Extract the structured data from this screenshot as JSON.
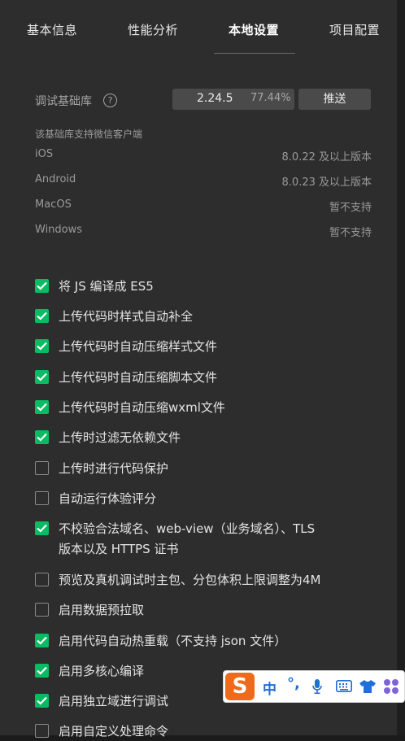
{
  "tabs": [
    {
      "label": "基本信息",
      "active": false
    },
    {
      "label": "性能分析",
      "active": false
    },
    {
      "label": "本地设置",
      "active": true
    },
    {
      "label": "项目配置",
      "active": false
    }
  ],
  "debug_lib": {
    "label": "调试基础库",
    "help_icon": "?",
    "version": "2.24.5",
    "percent": "77.44%",
    "push_label": "推送"
  },
  "support": {
    "title": "该基础库支持微信客户端",
    "rows": [
      {
        "name": "iOS",
        "value": "8.0.22 及以上版本"
      },
      {
        "name": "Android",
        "value": "8.0.23 及以上版本"
      },
      {
        "name": "MacOS",
        "value": "暂不支持"
      },
      {
        "name": "Windows",
        "value": "暂不支持"
      }
    ]
  },
  "options": [
    {
      "label": "将 JS 编译成 ES5",
      "checked": true
    },
    {
      "label": "上传代码时样式自动补全",
      "checked": true
    },
    {
      "label": "上传代码时自动压缩样式文件",
      "checked": true
    },
    {
      "label": "上传代码时自动压缩脚本文件",
      "checked": true
    },
    {
      "label": "上传代码时自动压缩wxml文件",
      "checked": true
    },
    {
      "label": "上传时过滤无依赖文件",
      "checked": true
    },
    {
      "label": "上传时进行代码保护",
      "checked": false
    },
    {
      "label": "自动运行体验评分",
      "checked": false
    },
    {
      "label": "不校验合法域名、web-view（业务域名）、TLS",
      "label2": "版本以及 HTTPS 证书",
      "checked": true
    },
    {
      "label": "预览及真机调试时主包、分包体积上限调整为4M",
      "checked": false
    },
    {
      "label": "启用数据预拉取",
      "checked": false
    },
    {
      "label": "启用代码自动热重载（不支持 json 文件）",
      "checked": true
    },
    {
      "label": "启用多核心编译",
      "checked": true
    },
    {
      "label": "启用独立域进行调试",
      "checked": true
    },
    {
      "label": "启用自定义处理命令",
      "checked": false
    }
  ],
  "ime_toolbar": {
    "logo": "S",
    "mode": "中",
    "punct": "°,",
    "icons": [
      "microphone-icon",
      "keyboard-icon",
      "skin-shirt-icon",
      "apps-grid-icon"
    ],
    "colors": {
      "logo": "#ee6b1c",
      "accent": "#1f6fd6"
    }
  },
  "colors": {
    "panel": "#2d2d2d",
    "check": "#09bb63",
    "button": "#4a4a4a"
  }
}
